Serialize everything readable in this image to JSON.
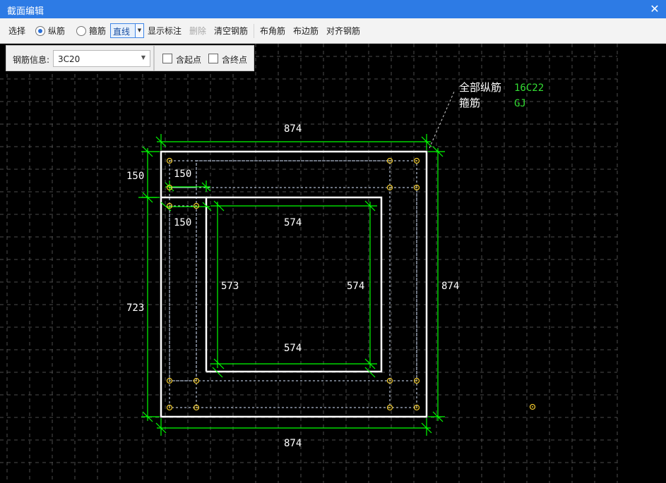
{
  "window": {
    "title": "截面编辑",
    "close_glyph": "✕"
  },
  "toolbar": {
    "select_label": "选择",
    "longitudinal_label": "纵筋",
    "stirrup_label": "箍筋",
    "line_mode": "直线",
    "show_dims_label": "显示标注",
    "delete_label": "删除",
    "clear_label": "清空钢筋",
    "corner_label": "布角筋",
    "edge_label": "布边筋",
    "align_label": "对齐钢筋"
  },
  "rebar_panel": {
    "info_label": "钢筋信息:",
    "info_value": "3C20",
    "start_label": "含起点",
    "end_label": "含终点"
  },
  "legend": {
    "all_long_label": "全部纵筋",
    "all_long_value": "16C22",
    "stirrup_label": "箍筋",
    "stirrup_value": "GJ"
  },
  "dimensions": {
    "top": "874",
    "bottom": "874",
    "right": "874",
    "left": "723",
    "leg_top_left": "150",
    "leg_horizontal": "150",
    "leg_inner": "150",
    "inner_top": "574",
    "inner_bottom": "574",
    "inner_left": "573",
    "inner_right": "574"
  },
  "colors": {
    "titlebar": "#2d7be5",
    "canvas": "#000000",
    "dimension_line": "#00ff00",
    "section_outline": "#ffffff",
    "rebar": "#e8c22c",
    "legend_value": "#33dd33",
    "grid": "#8c8c8c"
  }
}
